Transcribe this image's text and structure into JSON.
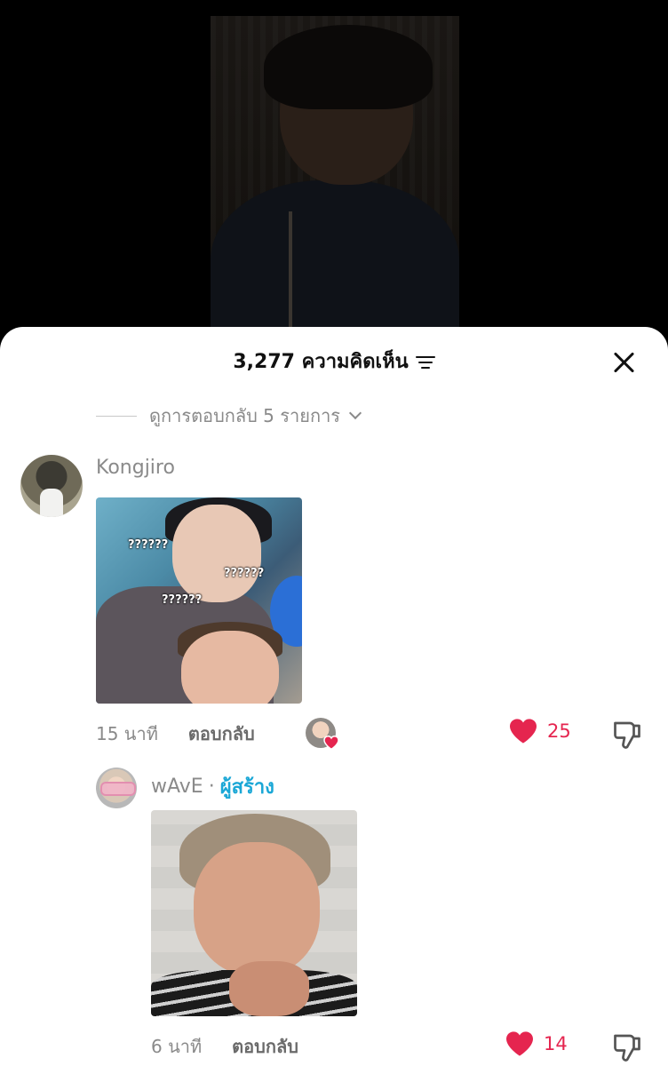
{
  "header": {
    "comment_count_title": "3,277 ความคิดเห็น",
    "filter_icon": "filter-icon",
    "close_icon": "close-icon"
  },
  "view_replies": {
    "label": "ดูการตอบกลับ 5 รายการ",
    "icon": "chevron-down-icon"
  },
  "comments": [
    {
      "username": "Kongjiro",
      "sticker_texts": [
        "??????",
        "??????",
        "??????"
      ],
      "time": "15 นาที",
      "reply_label": "ตอบกลับ",
      "liked_by_creator": true,
      "like_count": "25"
    },
    {
      "username": "wAvE",
      "separator": "·",
      "creator_badge": "ผู้สร้าง",
      "time": "6 นาที",
      "reply_label": "ตอบกลับ",
      "like_count": "14"
    }
  ],
  "colors": {
    "like_red": "#e5254f",
    "creator_blue": "#1aa7d6",
    "muted_text": "#8a8a8a"
  }
}
